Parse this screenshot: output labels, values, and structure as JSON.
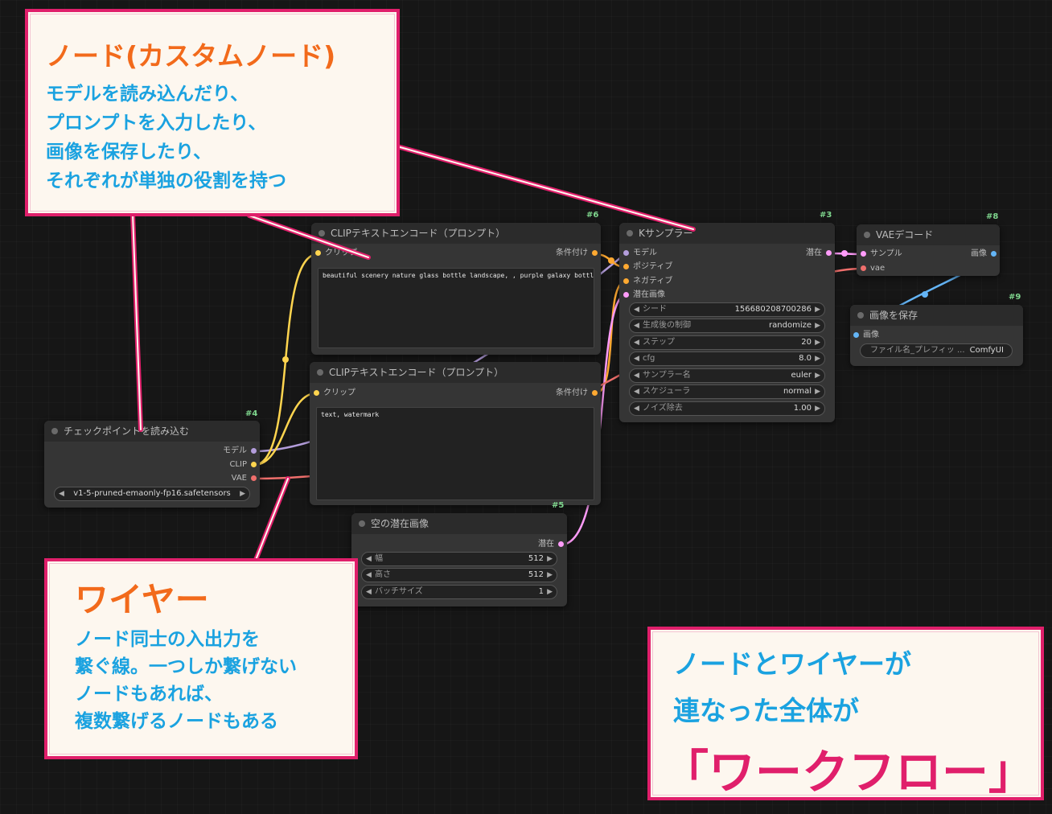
{
  "nodes": {
    "checkpoint": {
      "id": "#4",
      "title": "チェックポイントを読み込む",
      "outputs": [
        "モデル",
        "CLIP",
        "VAE"
      ],
      "ckpt_name": "v1-5-pruned-emaonly-fp16.safetensors"
    },
    "clip_positive": {
      "id": "#6",
      "title": "CLIPテキストエンコード（プロンプト）",
      "input": "クリップ",
      "output": "条件付け",
      "text": "beautiful scenery nature glass bottle landscape, , purple galaxy bottle,"
    },
    "clip_negative": {
      "id": "",
      "title": "CLIPテキストエンコード（プロンプト）",
      "input": "クリップ",
      "output": "条件付け",
      "text": "text, watermark"
    },
    "ksampler": {
      "id": "#3",
      "title": "Kサンプラー",
      "inputs": [
        "モデル",
        "ポジティブ",
        "ネガティブ",
        "潜在画像"
      ],
      "output": "潜在",
      "widgets": [
        {
          "label": "シード",
          "value": "156680208700286"
        },
        {
          "label": "生成後の制御",
          "value": "randomize"
        },
        {
          "label": "ステップ",
          "value": "20"
        },
        {
          "label": "cfg",
          "value": "8.0"
        },
        {
          "label": "サンプラー名",
          "value": "euler"
        },
        {
          "label": "スケジューラ",
          "value": "normal"
        },
        {
          "label": "ノイズ除去",
          "value": "1.00"
        }
      ]
    },
    "vae_decode": {
      "id": "#8",
      "title": "VAEデコード",
      "inputs": [
        "サンプル",
        "vae"
      ],
      "output": "画像"
    },
    "save_image": {
      "id": "#9",
      "title": "画像を保存",
      "input": "画像",
      "filename_label": "ファイル名_プレフィッ ...",
      "filename_value": "ComfyUI"
    },
    "empty_latent": {
      "id": "#5",
      "title": "空の潜在画像",
      "output": "潜在",
      "widgets": [
        {
          "label": "幅",
          "value": "512"
        },
        {
          "label": "高さ",
          "value": "512"
        },
        {
          "label": "バッチサイズ",
          "value": "1"
        }
      ]
    }
  },
  "callouts": {
    "node": {
      "title": "ノード(カスタムノード)",
      "lines": [
        "モデルを読み込んだり、",
        "プロンプトを入力したり、",
        "画像を保存したり、",
        "それぞれが単独の役割を持つ"
      ]
    },
    "wire": {
      "title": "ワイヤー",
      "lines": [
        "ノード同士の入出力を",
        "繋ぐ線。一つしか繋げない",
        "ノードもあれば、",
        "複数繋げるノードもある"
      ]
    },
    "workflow": {
      "lines": [
        "ノードとワイヤーが",
        "連なった全体が"
      ],
      "title": "「ワークフロー」"
    }
  },
  "colors": {
    "model": "#b39ddb",
    "clip": "#ffd54f",
    "vae": "#ef6f6c",
    "conditioning": "#ffa931",
    "latent": "#ff9cf9",
    "image": "#64b5f6",
    "callout_border": "#e01f6b",
    "callout_title": "#f26a1b",
    "callout_body": "#1aa2e0"
  }
}
